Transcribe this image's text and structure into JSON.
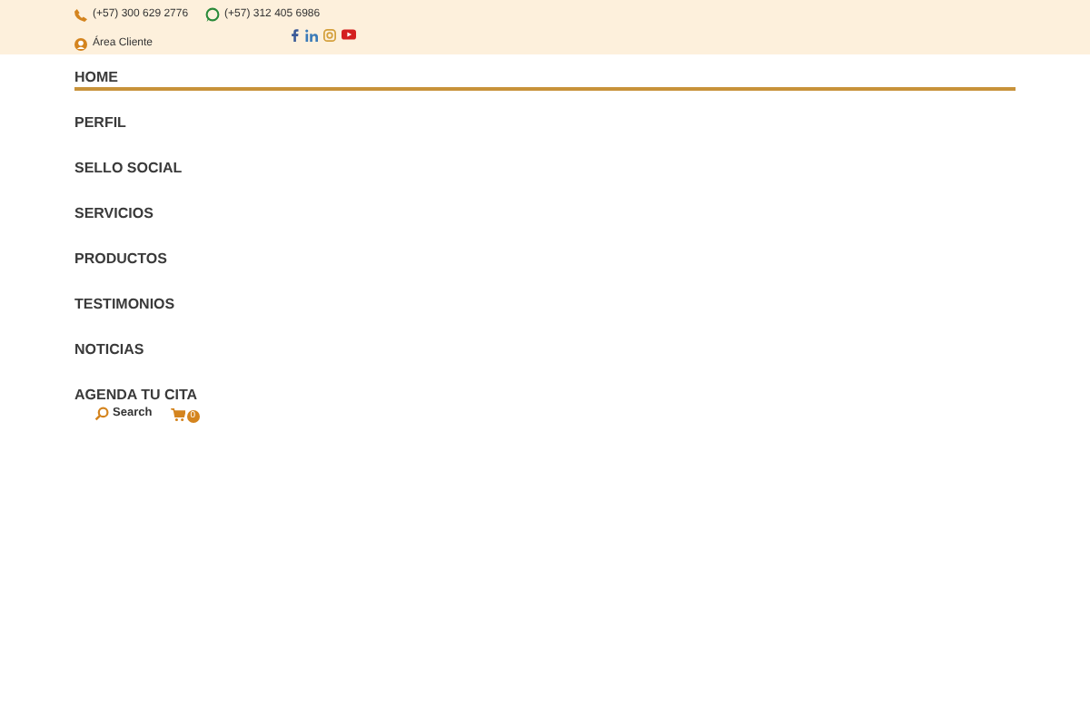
{
  "top_bar": {
    "phone": "(+57) 300 629 2776",
    "whatsapp": "(+57) 312 405 6986",
    "client_area": "Área Cliente"
  },
  "menu": [
    {
      "label": "HOME",
      "selected": true
    },
    {
      "label": "PERFIL",
      "selected": false
    },
    {
      "label": "SELLO SOCIAL",
      "selected": false
    },
    {
      "label": "SERVICIOS",
      "selected": false
    },
    {
      "label": "PRODUCTOS",
      "selected": false
    },
    {
      "label": "TESTIMONIOS",
      "selected": false
    },
    {
      "label": "NOTICIAS",
      "selected": false
    },
    {
      "label": "AGENDA TU CITA",
      "selected": false
    }
  ],
  "search": {
    "label": "Search"
  },
  "cart": {
    "count": "0"
  }
}
